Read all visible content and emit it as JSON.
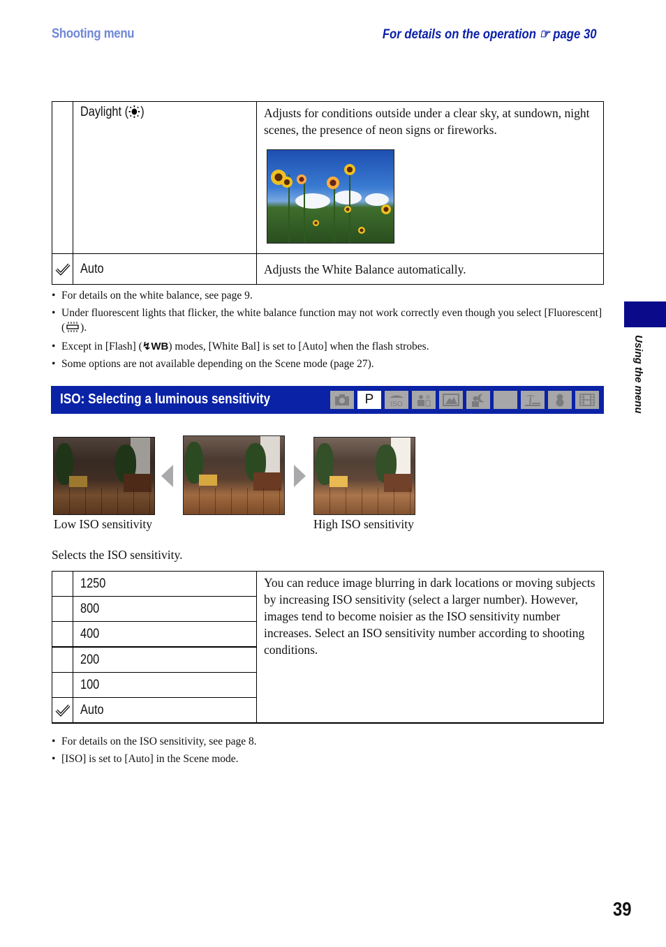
{
  "header": {
    "section": "Shooting menu",
    "reference_text": "For details on the operation",
    "reference_icon": "hand-pointer-icon",
    "reference_page": "page 30"
  },
  "white_balance_table": {
    "rows": [
      {
        "selected": false,
        "name": "Daylight (",
        "name_icon": "daylight-sun-icon",
        "name_suffix": ")",
        "description": "Adjusts for conditions outside under a clear sky, at sundown, night scenes, the presence of neon signs or fireworks.",
        "image": "sunflowers-photo"
      },
      {
        "selected": true,
        "name": "Auto",
        "description": "Adjusts the White Balance automatically."
      }
    ]
  },
  "white_balance_notes": [
    {
      "text": "For details on the white balance, see page 9."
    },
    {
      "text_before": "Under fluorescent lights that flicker, the white balance function may not work correctly even though you select [Fluorescent] (",
      "icon": "fluorescent-icon",
      "text_after": ")."
    },
    {
      "text_before": "Except in [Flash] (",
      "icon": "flash-wb-icon",
      "icon_label": "WB",
      "text_after": ") modes, [White Bal] is set to [Auto] when the flash strobes."
    },
    {
      "text": "Some options are not available depending on the Scene mode (page 27)."
    }
  ],
  "iso_section": {
    "title": "ISO: Selecting a luminous sensitivity",
    "bar_color": "#0a22a6",
    "modes": [
      {
        "name": "auto-camera-mode-icon",
        "active": false
      },
      {
        "name": "program-mode",
        "label": "P",
        "active": true
      },
      {
        "name": "high-sensitivity-mode-icon",
        "active": false
      },
      {
        "name": "soft-snap-mode-icon",
        "active": false
      },
      {
        "name": "landscape-mode-icon",
        "active": false
      },
      {
        "name": "twilight-portrait-mode-icon",
        "active": false
      },
      {
        "name": "twilight-mode-icon",
        "active": false
      },
      {
        "name": "beach-mode-icon",
        "active": false
      },
      {
        "name": "snow-mode-icon",
        "active": false
      },
      {
        "name": "movie-mode-icon",
        "active": false
      }
    ],
    "samples": {
      "low_caption": "Low ISO sensitivity",
      "high_caption": "High ISO sensitivity"
    },
    "intro": "Selects the ISO sensitivity.",
    "options": [
      {
        "label": "1250",
        "selected": false
      },
      {
        "label": "800",
        "selected": false
      },
      {
        "label": "400",
        "selected": false
      },
      {
        "label": "200",
        "selected": false
      },
      {
        "label": "100",
        "selected": false
      },
      {
        "label": "Auto",
        "selected": true
      }
    ],
    "description": "You can reduce image blurring in dark locations or moving subjects by increasing ISO sensitivity (select a larger number). However, images tend to become noisier as the ISO sensitivity number increases. Select an ISO sensitivity number according to shooting conditions.",
    "notes": [
      "For details on the ISO sensitivity, see page 8.",
      "[ISO] is set to [Auto] in the Scene mode."
    ]
  },
  "side_tab": {
    "label": "Using the menu",
    "color": "#0a0a8a"
  },
  "page_number": "39"
}
